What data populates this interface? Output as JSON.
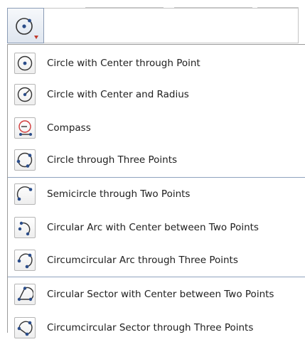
{
  "toolbar": {
    "active_tool_icon": "circle-center-point-icon",
    "active_tool_has_dropdown": true
  },
  "menu": {
    "groups": [
      {
        "items": [
          {
            "label": "Circle with Center through Point",
            "icon": "circle-center-point-icon"
          },
          {
            "label": "Circle with Center and Radius",
            "icon": "circle-center-radius-icon"
          },
          {
            "label": "Compass",
            "icon": "compass-icon"
          },
          {
            "label": "Circle through Three Points",
            "icon": "circle-three-points-icon"
          }
        ]
      },
      {
        "items": [
          {
            "label": "Semicircle through Two Points",
            "icon": "semicircle-icon"
          },
          {
            "label": "Circular Arc with Center between Two Points",
            "icon": "circular-arc-center-icon"
          },
          {
            "label": "Circumcircular Arc through Three Points",
            "icon": "circumcircular-arc-icon"
          }
        ]
      },
      {
        "items": [
          {
            "label": "Circular Sector with Center between Two Points",
            "icon": "circular-sector-center-icon"
          },
          {
            "label": "Circumcircular Sector through Three Points",
            "icon": "circumcircular-sector-icon"
          }
        ]
      }
    ]
  },
  "colors": {
    "point_blue": "#2b4d8a",
    "line_dark": "#333333",
    "compass_red": "#d23a3a",
    "separator": "#8fa3be"
  }
}
